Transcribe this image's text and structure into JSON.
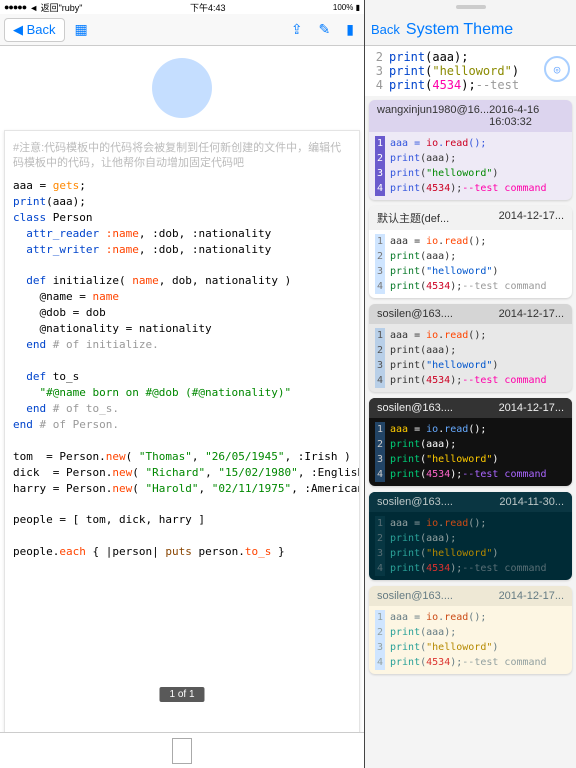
{
  "status": {
    "carrier": "●●●●●",
    "back_app": "返回\"ruby\"",
    "time": "下午4:43",
    "battery": "100%"
  },
  "left": {
    "back": "Back",
    "hint": "#注意:代码模板中的代码将会被复制到任何新创建的文件中，编辑代码模板中的代码，让他帮你自动增加固定代码吧",
    "page_indicator": "1 of 1",
    "code": {
      "l1_a": "aaa = ",
      "l1_b": "gets",
      "l1_c": ";",
      "l2_a": "print",
      "l2_b": "(aaa);",
      "l3_a": "class",
      "l3_b": " Person",
      "l4_a": "  attr_reader",
      "l4_b": " :name",
      "l4_c": ", :dob, :nationality",
      "l5_a": "  attr_writer",
      "l5_b": " :name",
      "l5_c": ", :dob, :nationality",
      "l6_a": "  def",
      "l6_b": " initialize(",
      "l6_c": " name",
      "l6_d": ", dob, nationality )",
      "l7_a": "    @name = ",
      "l7_b": "name",
      "l8": "    @dob = dob",
      "l9": "    @nationality = nationality",
      "l10_a": "  end",
      "l10_b": " # of initialize.",
      "l11_a": "  def",
      "l11_b": " to_s",
      "l12": "    \"#@name born on #@dob (#@nationality)\"",
      "l13_a": "  end",
      "l13_b": " # of to_s.",
      "l14_a": "end",
      "l14_b": " # of Person.",
      "l15_a": "tom  = Person.",
      "l15_b": "new",
      "l15_c": "( ",
      "l15_d": "\"Thomas\"",
      "l15_e": ", ",
      "l15_f": "\"26/05/1945\"",
      "l15_g": ", :Irish )",
      "l16_a": "dick  = Person.",
      "l16_b": "new",
      "l16_c": "( ",
      "l16_d": "\"Richard\"",
      "l16_e": ", ",
      "l16_f": "\"15/02/1980\"",
      "l16_g": ", :English )",
      "l17_a": "harry = Person.",
      "l17_b": "new",
      "l17_c": "( ",
      "l17_d": "\"Harold\"",
      "l17_e": ", ",
      "l17_f": "\"02/11/1975\"",
      "l17_g": ", :American )",
      "l18": "people = [ tom, dick, harry ]",
      "l19_a": "people.",
      "l19_b": "each",
      "l19_c": " { |person| ",
      "l19_d": "puts",
      "l19_e": " person.",
      "l19_f": "to_s",
      "l19_g": " }"
    }
  },
  "right": {
    "back": "Back",
    "title": "System Theme",
    "preview": {
      "l2": {
        "n": "2",
        "a": "print",
        "b": "(aaa);"
      },
      "l3": {
        "n": "3",
        "a": "print",
        "b": "(",
        "c": "\"helloword\"",
        "d": ")"
      },
      "l4": {
        "n": "4",
        "a": "print",
        "b": "(",
        "c": "4534",
        "d": ");",
        "e": "--test"
      }
    },
    "cards": [
      {
        "user": "wangxinjun1980@16...",
        "date": "2016-4-16 16:03:32",
        "bg": "#eeeaf6",
        "headbg": "#dcd4ee",
        "headfg": "#333",
        "lnbg": "#6a5acd",
        "lnfg": "#fff",
        "lines": [
          {
            "n": "1",
            "segs": [
              [
                "#3355dd",
                "aaa = "
              ],
              [
                "#cc0022",
                "io"
              ],
              [
                "#3355dd",
                "."
              ],
              [
                "#cc0022",
                "read"
              ],
              [
                "#3355dd",
                "();"
              ]
            ]
          },
          {
            "n": "2",
            "segs": [
              [
                "#3355dd",
                "print"
              ],
              [
                "#333",
                "(aaa);"
              ]
            ]
          },
          {
            "n": "3",
            "segs": [
              [
                "#3355dd",
                "print"
              ],
              [
                "#333",
                "("
              ],
              [
                "#008800",
                "\"helloword\""
              ],
              [
                "#333",
                ")"
              ]
            ]
          },
          {
            "n": "4",
            "segs": [
              [
                "#3355dd",
                "print"
              ],
              [
                "#333",
                "("
              ],
              [
                "#cc0022",
                "4534"
              ],
              [
                "#333",
                ");"
              ],
              [
                "#ff00aa",
                "--test command"
              ]
            ]
          }
        ]
      },
      {
        "user": "默认主题(def...",
        "date": "2014-12-17...",
        "bg": "#fff",
        "headbg": "#f2f2f2",
        "headfg": "#333",
        "lnbg": "#cfe5ff",
        "lnfg": "#777",
        "lines": [
          {
            "n": "1",
            "segs": [
              [
                "#333",
                "aaa = "
              ],
              [
                "#ff4400",
                "io"
              ],
              [
                "#333",
                "."
              ],
              [
                "#ff4400",
                "read"
              ],
              [
                "#333",
                "();"
              ]
            ]
          },
          {
            "n": "2",
            "segs": [
              [
                "#0a7a2a",
                "print"
              ],
              [
                "#333",
                "(aaa);"
              ]
            ]
          },
          {
            "n": "3",
            "segs": [
              [
                "#0a7a2a",
                "print"
              ],
              [
                "#333",
                "("
              ],
              [
                "#0055cc",
                "\"helloword\""
              ],
              [
                "#333",
                ")"
              ]
            ]
          },
          {
            "n": "4",
            "segs": [
              [
                "#0a7a2a",
                "print"
              ],
              [
                "#333",
                "("
              ],
              [
                "#cc0022",
                "4534"
              ],
              [
                "#333",
                ");"
              ],
              [
                "#999",
                "--test command"
              ]
            ]
          }
        ]
      },
      {
        "user": "sosilen@163....",
        "date": "2014-12-17...",
        "bg": "#e8e8e8",
        "headbg": "#d5d5d5",
        "headfg": "#333",
        "lnbg": "#b8cfe8",
        "lnfg": "#555",
        "lines": [
          {
            "n": "1",
            "segs": [
              [
                "#333",
                "aaa = "
              ],
              [
                "#ff4400",
                "io"
              ],
              [
                "#333",
                "."
              ],
              [
                "#ff4400",
                "read"
              ],
              [
                "#333",
                "();"
              ]
            ]
          },
          {
            "n": "2",
            "segs": [
              [
                "#333",
                "print(aaa);"
              ]
            ]
          },
          {
            "n": "3",
            "segs": [
              [
                "#333",
                "print("
              ],
              [
                "#0055cc",
                "\"helloword\""
              ],
              [
                "#333",
                ")"
              ]
            ]
          },
          {
            "n": "4",
            "segs": [
              [
                "#333",
                "print("
              ],
              [
                "#cc0022",
                "4534"
              ],
              [
                "#333",
                ");"
              ],
              [
                "#ff00aa",
                "--test command"
              ]
            ]
          }
        ]
      },
      {
        "user": "sosilen@163....",
        "date": "2014-12-17...",
        "bg": "#111",
        "headbg": "#333",
        "headfg": "#eee",
        "lnbg": "#224466",
        "lnfg": "#ccc",
        "lines": [
          {
            "n": "1",
            "segs": [
              [
                "#ffcc00",
                "aaa "
              ],
              [
                "#fff",
                "= "
              ],
              [
                "#66aaff",
                "io"
              ],
              [
                "#fff",
                "."
              ],
              [
                "#66aaff",
                "read"
              ],
              [
                "#fff",
                "();"
              ]
            ]
          },
          {
            "n": "2",
            "segs": [
              [
                "#00cc77",
                "print"
              ],
              [
                "#fff",
                "(aaa);"
              ]
            ]
          },
          {
            "n": "3",
            "segs": [
              [
                "#00cc77",
                "print"
              ],
              [
                "#fff",
                "("
              ],
              [
                "#ffcc00",
                "\"helloword\""
              ],
              [
                "#fff",
                ")"
              ]
            ]
          },
          {
            "n": "4",
            "segs": [
              [
                "#00cc77",
                "print"
              ],
              [
                "#fff",
                "("
              ],
              [
                "#ff66cc",
                "4534"
              ],
              [
                "#fff",
                ");"
              ],
              [
                "#aa66ff",
                "--test command"
              ]
            ]
          }
        ]
      },
      {
        "user": "sosilen@163....",
        "date": "2014-11-30...",
        "bg": "#002b36",
        "headbg": "#0a3642",
        "headfg": "#bcc6c6",
        "lnbg": "#073642",
        "lnfg": "#586e75",
        "lines": [
          {
            "n": "1",
            "segs": [
              [
                "#93a1a1",
                "aaa = "
              ],
              [
                "#cb4b16",
                "io"
              ],
              [
                "#93a1a1",
                "."
              ],
              [
                "#cb4b16",
                "read"
              ],
              [
                "#93a1a1",
                "();"
              ]
            ]
          },
          {
            "n": "2",
            "segs": [
              [
                "#2aa198",
                "print"
              ],
              [
                "#93a1a1",
                "(aaa);"
              ]
            ]
          },
          {
            "n": "3",
            "segs": [
              [
                "#2aa198",
                "print"
              ],
              [
                "#93a1a1",
                "("
              ],
              [
                "#b58900",
                "\"helloword\""
              ],
              [
                "#93a1a1",
                ")"
              ]
            ]
          },
          {
            "n": "4",
            "segs": [
              [
                "#2aa198",
                "print"
              ],
              [
                "#93a1a1",
                "("
              ],
              [
                "#dc322f",
                "4534"
              ],
              [
                "#93a1a1",
                ");"
              ],
              [
                "#586e75",
                "--test command"
              ]
            ]
          }
        ]
      },
      {
        "user": "sosilen@163....",
        "date": "2014-12-17...",
        "bg": "#fdf6e3",
        "headbg": "#eee8d5",
        "headfg": "#657b83",
        "lnbg": "#cfe5ff",
        "lnfg": "#93a1a1",
        "lines": [
          {
            "n": "1",
            "segs": [
              [
                "#657b83",
                "aaa = "
              ],
              [
                "#cb4b16",
                "io"
              ],
              [
                "#657b83",
                "."
              ],
              [
                "#cb4b16",
                "read"
              ],
              [
                "#657b83",
                "();"
              ]
            ]
          },
          {
            "n": "2",
            "segs": [
              [
                "#2aa198",
                "print"
              ],
              [
                "#657b83",
                "(aaa);"
              ]
            ]
          },
          {
            "n": "3",
            "segs": [
              [
                "#2aa198",
                "print"
              ],
              [
                "#657b83",
                "("
              ],
              [
                "#b58900",
                "\"helloword\""
              ],
              [
                "#657b83",
                ")"
              ]
            ]
          },
          {
            "n": "4",
            "segs": [
              [
                "#2aa198",
                "print"
              ],
              [
                "#657b83",
                "("
              ],
              [
                "#dc322f",
                "4534"
              ],
              [
                "#657b83",
                ");"
              ],
              [
                "#93a1a1",
                "--test command"
              ]
            ]
          }
        ]
      }
    ]
  }
}
